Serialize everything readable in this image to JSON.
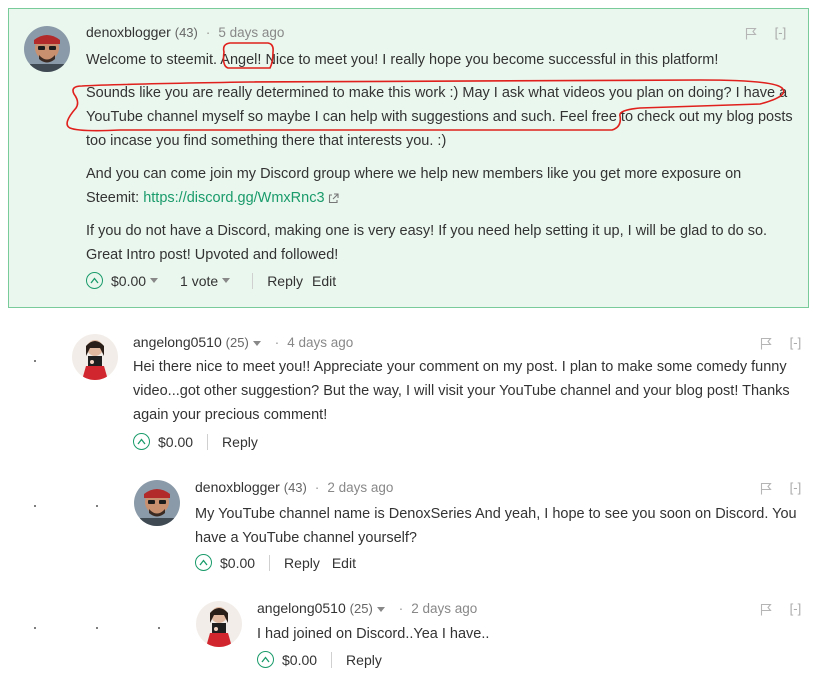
{
  "comments": [
    {
      "author": "denoxblogger",
      "rep": "(43)",
      "time": "5 days ago",
      "collapse": "[-]",
      "paragraphs": {
        "p1": "Welcome to steemit. Angel! Nice to meet you! I really hope you become successful in this platform!",
        "p2": "Sounds like you are really determined to make this work :) May I ask what videos you plan on doing? I have a YouTube channel myself so maybe I can help with suggestions and such. Feel free to check out my blog posts too incase you find something there that interests you. :)",
        "p3_before": "And you can come join my Discord group where we help new members like you get more exposure on Steemit: ",
        "p3_link": "https://discord.gg/WmxRnc3",
        "p4": "If you do not have a Discord, making one is very easy! If you need help setting it up, I will be glad to do so. Great Intro post! Upvoted and followed!"
      },
      "payout": "$0.00",
      "votes": "1 vote",
      "reply": "Reply",
      "edit": "Edit"
    },
    {
      "author": "angelong0510",
      "rep": "(25)",
      "time": "4 days ago",
      "collapse": "[-]",
      "text": "Hei there nice to meet you!! Appreciate your comment on my post. I plan to make some comedy funny video...got other suggestion? But the way, I will visit your YouTube channel and your blog post! Thanks again your precious comment!",
      "payout": "$0.00",
      "reply": "Reply"
    },
    {
      "author": "denoxblogger",
      "rep": "(43)",
      "time": "2 days ago",
      "collapse": "[-]",
      "text": "My YouTube channel name is DenoxSeries And yeah, I hope to see you soon on Discord. You have a YouTube channel yourself?",
      "payout": "$0.00",
      "reply": "Reply",
      "edit": "Edit"
    },
    {
      "author": "angelong0510",
      "rep": "(25)",
      "time": "2 days ago",
      "collapse": "[-]",
      "text": "I had joined on Discord..Yea I have..",
      "payout": "$0.00",
      "reply": "Reply"
    }
  ],
  "colors": {
    "highlight_bg": "#eaf7ee",
    "highlight_border": "#79cc99",
    "link": "#1a9b6b",
    "annotation": "#e0201c"
  },
  "icons": [
    "flag-icon",
    "upvote-icon",
    "external-link-icon",
    "caret-down-icon"
  ]
}
